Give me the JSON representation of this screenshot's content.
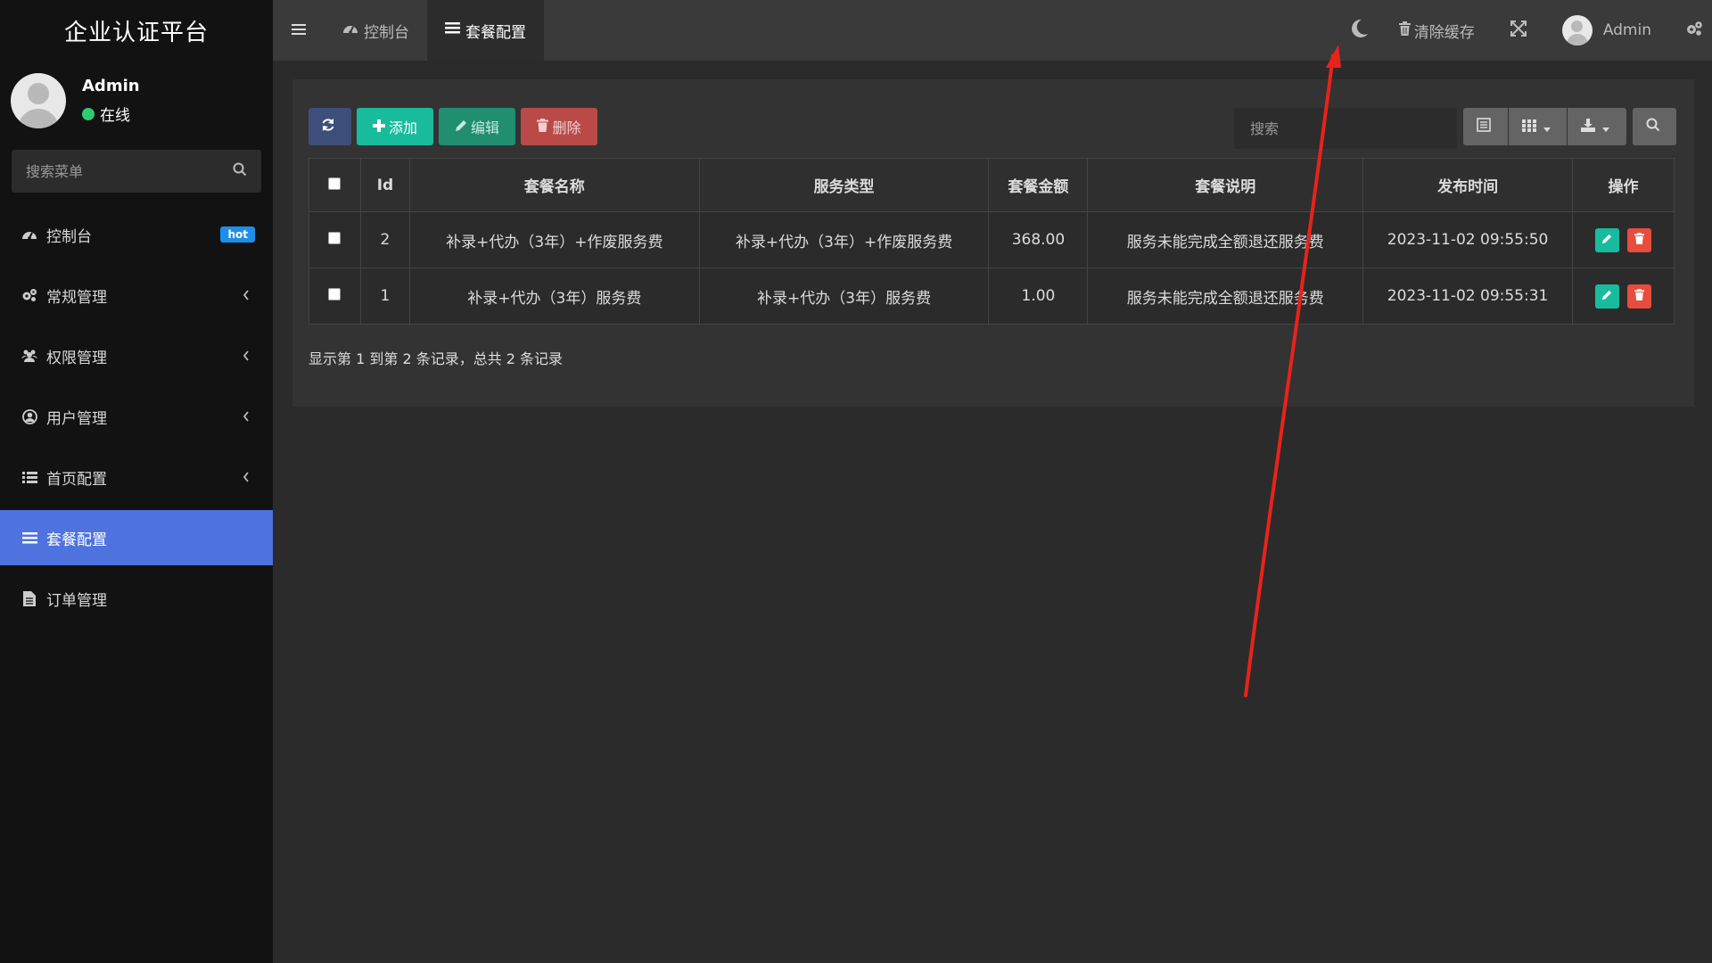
{
  "app": {
    "brand": "企业认证平台"
  },
  "user": {
    "name": "Admin",
    "status": "在线"
  },
  "sidebar": {
    "search_placeholder": "搜索菜单",
    "items": [
      {
        "label": "控制台",
        "icon": "dashboard-icon",
        "badge": "hot"
      },
      {
        "label": "常规管理",
        "icon": "cogs-icon"
      },
      {
        "label": "权限管理",
        "icon": "group-icon"
      },
      {
        "label": "用户管理",
        "icon": "user-circle-icon"
      },
      {
        "label": "首页配置",
        "icon": "list-icon"
      },
      {
        "label": "套餐配置",
        "icon": "list-icon",
        "active": true
      },
      {
        "label": "订单管理",
        "icon": "file-icon"
      }
    ]
  },
  "topbar": {
    "tabs": [
      {
        "label": "控制台"
      },
      {
        "label": "套餐配置",
        "active": true
      }
    ],
    "clear_cache": "清除缓存",
    "admin": "Admin"
  },
  "toolbar": {
    "add": "添加",
    "edit": "编辑",
    "delete": "删除",
    "search_placeholder": "搜索"
  },
  "table": {
    "headers": [
      "Id",
      "套餐名称",
      "服务类型",
      "套餐金额",
      "套餐说明",
      "发布时间",
      "操作"
    ],
    "rows": [
      {
        "id": "2",
        "name": "补录+代办（3年）+作废服务费",
        "type": "补录+代办（3年）+作废服务费",
        "amount": "368.00",
        "desc": "服务未能完成全额退还服务费",
        "time": "2023-11-02 09:55:50"
      },
      {
        "id": "1",
        "name": "补录+代办（3年）服务费",
        "type": "补录+代办（3年）服务费",
        "amount": "1.00",
        "desc": "服务未能完成全额退还服务费",
        "time": "2023-11-02 09:55:31"
      }
    ]
  },
  "pagination": {
    "info": "显示第 1 到第 2 条记录，总共 2 条记录"
  },
  "colors": {
    "sidebar_bg": "#121212",
    "active_menu": "#4e73df",
    "add_btn": "#18bc9c",
    "edit_btn": "#1f8f70",
    "delete_btn": "#d9534f",
    "refresh_btn": "#3d4e7a",
    "annotation_arrow": "#e8231a"
  }
}
